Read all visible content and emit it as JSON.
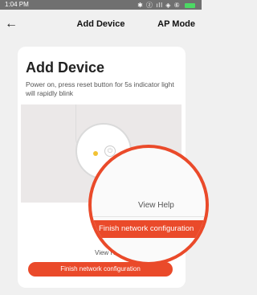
{
  "status_bar": {
    "time": "1:04 PM",
    "icons": "✱ ⓩ ıll ◈ ⑥"
  },
  "nav": {
    "back_icon": "←",
    "title": "Add Device",
    "right_action": "AP Mode"
  },
  "card": {
    "title": "Add Device",
    "description": "Power on, press reset button for 5s indicator light will rapidly blink"
  },
  "illustration": {
    "power_icon": "⏻"
  },
  "actions": {
    "view_help": "View Help",
    "finish": "Finish network configuration"
  },
  "magnifier": {
    "view_help": "View Help",
    "finish": "Finish network configuration"
  },
  "colors": {
    "accent": "#ea4a2a",
    "indicator": "#f2c233"
  }
}
